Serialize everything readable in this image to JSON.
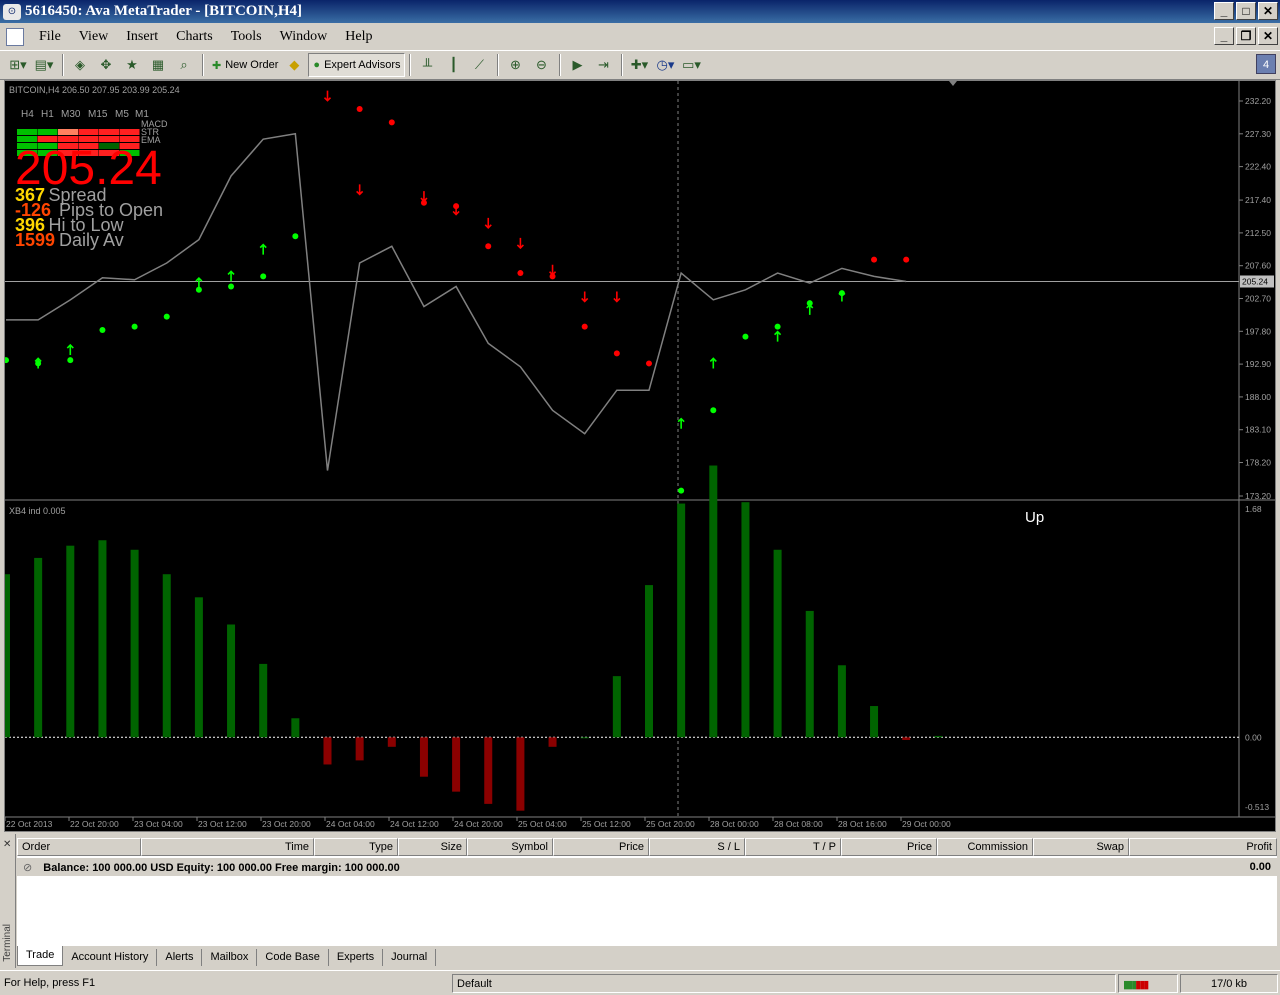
{
  "window": {
    "title": "5616450: Ava MetaTrader - [BITCOIN,H4]"
  },
  "menu": {
    "items": [
      "File",
      "View",
      "Insert",
      "Charts",
      "Tools",
      "Window",
      "Help"
    ]
  },
  "toolbar": {
    "new_order_label": "New Order",
    "expert_advisors_label": "Expert Advisors",
    "badge": "4"
  },
  "chart": {
    "header": "BITCOIN,H4  206.50 207.95 203.99 205.24",
    "timeframes": [
      "H4",
      "H1",
      "M30",
      "M15",
      "M5",
      "M1"
    ],
    "signal_labels": [
      "MACD",
      "STR",
      "EMA"
    ],
    "big_price": "205.24",
    "stats": [
      {
        "value": "367",
        "label": "Spread",
        "color": "#ffd700"
      },
      {
        "value": "-126",
        "label": "Pips to Open",
        "color": "#ff4500"
      },
      {
        "value": "396",
        "label": "Hi to Low",
        "color": "#ffd700"
      },
      {
        "value": "1599",
        "label": "Daily Av",
        "color": "#ff4500"
      }
    ],
    "price_axis": [
      "232.20",
      "227.30",
      "222.40",
      "217.40",
      "212.50",
      "207.60",
      "202.70",
      "197.80",
      "192.90",
      "188.00",
      "183.10",
      "178.20",
      "173.20"
    ],
    "current_price_tag": "205.24",
    "indicator_label": "XB4 ind 0.005",
    "indicator_status": "Up",
    "indicator_axis": [
      "1.68",
      "0.00",
      "-0.513"
    ],
    "time_axis": [
      "22 Oct 2013",
      "22 Oct 20:00",
      "23 Oct 04:00",
      "23 Oct 12:00",
      "23 Oct 20:00",
      "24 Oct 04:00",
      "24 Oct 12:00",
      "24 Oct 20:00",
      "25 Oct 04:00",
      "25 Oct 12:00",
      "25 Oct 20:00",
      "28 Oct 00:00",
      "28 Oct 08:00",
      "28 Oct 16:00",
      "29 Oct 00:00"
    ]
  },
  "chart_data": {
    "type": "line",
    "line_color": "#808080",
    "price_line_values": [
      199.5,
      199.5,
      202.5,
      205.8,
      205.5,
      208,
      211.5,
      221,
      226.5,
      227.3,
      177,
      208,
      210.5,
      201.5,
      204.5,
      196,
      192.5,
      186,
      182.5,
      189,
      189,
      206.5,
      202.5,
      204,
      206.5,
      205,
      207.2,
      206.0,
      205.24
    ],
    "histogram_color_up": "#006400",
    "histogram_color_down": "#8b0000",
    "histogram_values": [
      1.2,
      1.32,
      1.41,
      1.45,
      1.38,
      1.2,
      1.03,
      0.83,
      0.54,
      0.14,
      -0.2,
      -0.17,
      -0.07,
      -0.29,
      -0.4,
      -0.49,
      -0.54,
      -0.07,
      0,
      0.45,
      1.12,
      1.72,
      2.0,
      1.73,
      1.38,
      0.93,
      0.53,
      0.23,
      -0.02,
      0.01
    ],
    "arrows_up_green": [
      [
        1,
        193
      ],
      [
        2,
        195
      ],
      [
        6,
        205
      ],
      [
        7,
        206
      ],
      [
        8,
        210
      ],
      [
        21,
        184
      ],
      [
        22,
        193
      ],
      [
        24,
        197
      ],
      [
        25,
        201
      ],
      [
        26,
        203
      ]
    ],
    "arrows_down_red": [
      [
        10,
        233
      ],
      [
        11,
        219
      ],
      [
        13,
        218
      ],
      [
        14,
        216
      ],
      [
        15,
        214
      ],
      [
        16,
        211
      ],
      [
        17,
        207
      ],
      [
        18,
        203
      ],
      [
        19,
        203
      ]
    ],
    "dots_green": [
      [
        0,
        193.5
      ],
      [
        1,
        193
      ],
      [
        2,
        193.5
      ],
      [
        3,
        198
      ],
      [
        4,
        198.5
      ],
      [
        5,
        200
      ],
      [
        6,
        204
      ],
      [
        7,
        204.5
      ],
      [
        8,
        206
      ],
      [
        9,
        212
      ],
      [
        21,
        174
      ],
      [
        22,
        186
      ],
      [
        23,
        197
      ],
      [
        24,
        198.5
      ],
      [
        25,
        202
      ],
      [
        26,
        203.5
      ]
    ],
    "dots_red": [
      [
        11,
        231
      ],
      [
        12,
        229
      ],
      [
        13,
        217
      ],
      [
        14,
        216.5
      ],
      [
        15,
        210.5
      ],
      [
        16,
        206.5
      ],
      [
        17,
        206
      ],
      [
        18,
        198.5
      ],
      [
        19,
        194.5
      ],
      [
        20,
        193
      ],
      [
        27,
        208.5
      ],
      [
        28,
        208.5
      ]
    ],
    "ylim": [
      173.2,
      232.2
    ],
    "indicator_ylim": [
      -0.513,
      1.68
    ]
  },
  "terminal": {
    "side_label": "Terminal",
    "columns": [
      "Order",
      "Time",
      "Type",
      "Size",
      "Symbol",
      "Price",
      "S / L",
      "T / P",
      "Price",
      "Commission",
      "Swap",
      "Profit"
    ],
    "balance_text": "Balance: 100 000.00 USD  Equity: 100 000.00  Free margin: 100 000.00",
    "profit": "0.00",
    "tabs": [
      "Trade",
      "Account History",
      "Alerts",
      "Mailbox",
      "Code Base",
      "Experts",
      "Journal"
    ],
    "active_tab": "Trade"
  },
  "status": {
    "help": "For Help, press F1",
    "profile": "Default",
    "traffic": "17/0 kb"
  }
}
